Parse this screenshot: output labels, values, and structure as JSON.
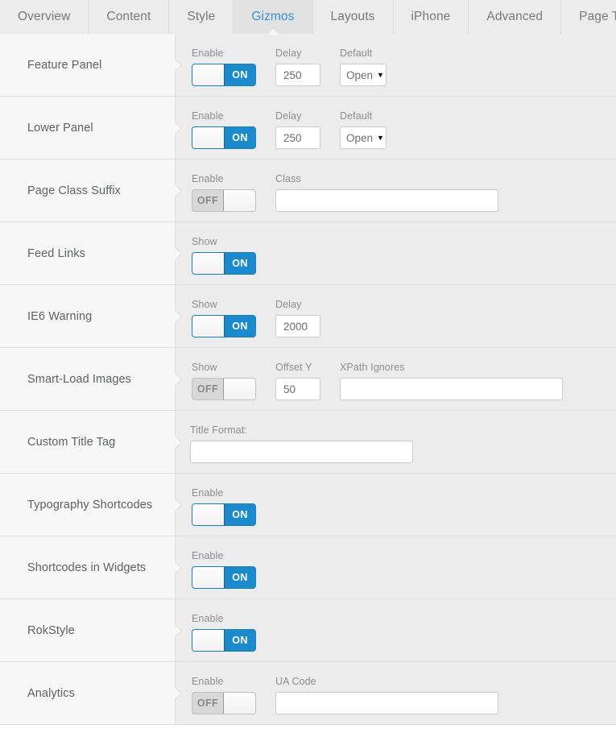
{
  "tabs": [
    {
      "label": "Overview",
      "active": false
    },
    {
      "label": "Content",
      "active": false
    },
    {
      "label": "Style",
      "active": false
    },
    {
      "label": "Gizmos",
      "active": true
    },
    {
      "label": "Layouts",
      "active": false
    },
    {
      "label": "iPhone",
      "active": false
    },
    {
      "label": "Advanced",
      "active": false
    },
    {
      "label": "Page Templates",
      "active": false
    }
  ],
  "colors": {
    "accent": "#1b8bcd",
    "active_tab_text": "#3b8ed0",
    "label_column_bg": "#f7f7f7",
    "control_column_bg": "#ececec",
    "toggle_off_bg": "#d8d8d8",
    "row_border": "#dedede"
  },
  "rows": [
    {
      "label": "Feature Panel",
      "fields": [
        {
          "kind": "toggle",
          "label": "Enable",
          "state": "ON",
          "name": "enable-toggle"
        },
        {
          "kind": "number",
          "label": "Delay",
          "value": "250",
          "name": "delay-input"
        },
        {
          "kind": "select",
          "label": "Default",
          "value": "Open",
          "name": "default-select"
        }
      ]
    },
    {
      "label": "Lower Panel",
      "fields": [
        {
          "kind": "toggle",
          "label": "Enable",
          "state": "ON",
          "name": "enable-toggle"
        },
        {
          "kind": "number",
          "label": "Delay",
          "value": "250",
          "name": "delay-input"
        },
        {
          "kind": "select",
          "label": "Default",
          "value": "Open",
          "name": "default-select"
        }
      ]
    },
    {
      "label": "Page Class Suffix",
      "fields": [
        {
          "kind": "toggle",
          "label": "Enable",
          "state": "OFF",
          "name": "enable-toggle"
        },
        {
          "kind": "text",
          "label": "Class",
          "value": "",
          "placeholder": "",
          "width": "class-input",
          "name": "class-input"
        }
      ]
    },
    {
      "label": "Feed Links",
      "fields": [
        {
          "kind": "toggle",
          "label": "Show",
          "state": "ON",
          "name": "show-toggle"
        }
      ]
    },
    {
      "label": "IE6 Warning",
      "fields": [
        {
          "kind": "toggle",
          "label": "Show",
          "state": "ON",
          "name": "show-toggle"
        },
        {
          "kind": "number",
          "label": "Delay",
          "value": "2000",
          "name": "delay-input"
        }
      ]
    },
    {
      "label": "Smart-Load Images",
      "fields": [
        {
          "kind": "toggle",
          "label": "Show",
          "state": "OFF",
          "name": "show-toggle"
        },
        {
          "kind": "number",
          "label": "Offset Y",
          "value": "50",
          "name": "offset-y-input"
        },
        {
          "kind": "text",
          "label": "XPath Ignores",
          "value": "",
          "placeholder": "",
          "width": "xpath-input",
          "name": "xpath-ignores-input"
        }
      ]
    },
    {
      "label": "Custom Title Tag",
      "fields": [
        {
          "kind": "text",
          "label": "Title Format:",
          "value": "",
          "placeholder": "",
          "width": "title-input",
          "name": "title-format-input",
          "variant": "titlefmt"
        }
      ]
    },
    {
      "label": "Typography Shortcodes",
      "fields": [
        {
          "kind": "toggle",
          "label": "Enable",
          "state": "ON",
          "name": "enable-toggle"
        }
      ]
    },
    {
      "label": "Shortcodes in Widgets",
      "fields": [
        {
          "kind": "toggle",
          "label": "Enable",
          "state": "ON",
          "name": "enable-toggle"
        }
      ]
    },
    {
      "label": "RokStyle",
      "fields": [
        {
          "kind": "toggle",
          "label": "Enable",
          "state": "ON",
          "name": "enable-toggle"
        }
      ]
    },
    {
      "label": "Analytics",
      "fields": [
        {
          "kind": "toggle",
          "label": "Enable",
          "state": "OFF",
          "name": "enable-toggle"
        },
        {
          "kind": "text",
          "label": "UA Code",
          "value": "",
          "placeholder": "",
          "width": "ua-input",
          "name": "ua-code-input"
        }
      ]
    }
  ]
}
